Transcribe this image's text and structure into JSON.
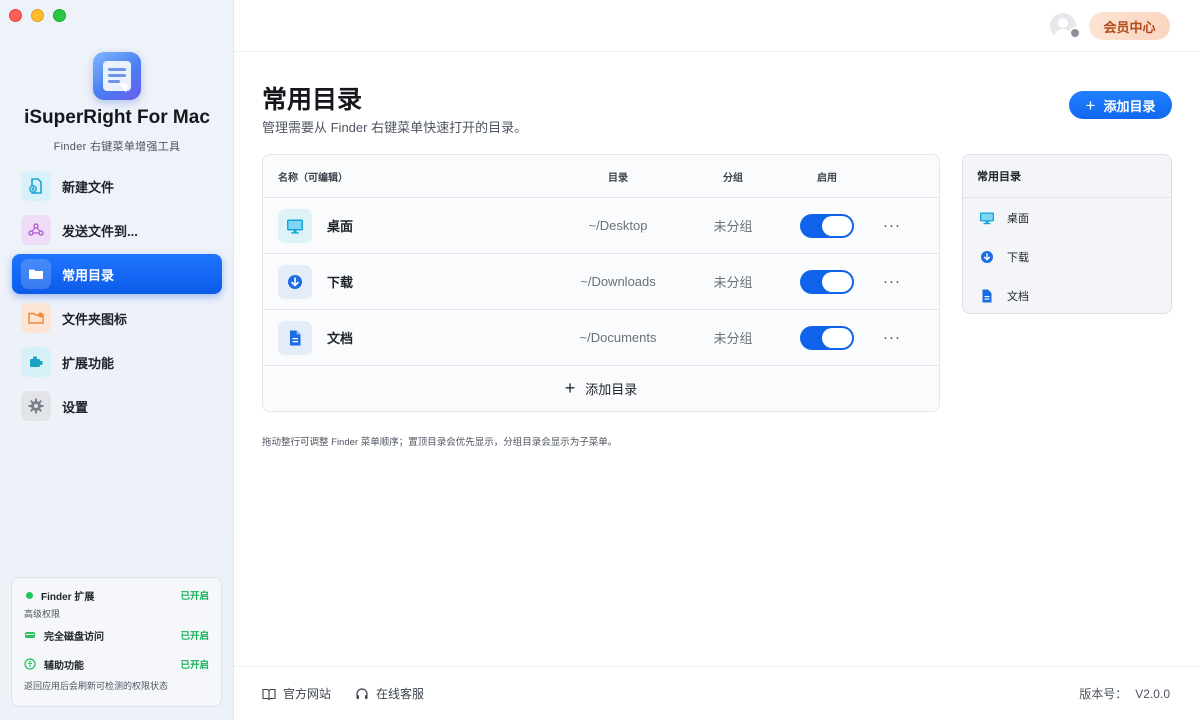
{
  "app": {
    "name": "iSuperRight For Mac",
    "subtitle": "Finder 右键菜单增强工具"
  },
  "sidebar": {
    "items": [
      {
        "label": "新建文件",
        "icon": "new-file-icon",
        "active": false
      },
      {
        "label": "发送文件到...",
        "icon": "send-file-icon",
        "active": false
      },
      {
        "label": "常用目录",
        "icon": "folder-icon",
        "active": true
      },
      {
        "label": "文件夹图标",
        "icon": "folder-image-icon",
        "active": false
      },
      {
        "label": "扩展功能",
        "icon": "extension-icon",
        "active": false
      },
      {
        "label": "设置",
        "icon": "gear-icon",
        "active": false
      }
    ]
  },
  "permissions": {
    "finder_ext": {
      "label": "Finder 扩展",
      "status": "已开启"
    },
    "advanced_label": "高级权限",
    "disk_access": {
      "label": "完全磁盘访问",
      "status": "已开启"
    },
    "accessibility": {
      "label": "辅助功能",
      "status": "已开启"
    },
    "note": "返回应用后会刷新可检测的权限状态"
  },
  "header": {
    "member_label": "会员中心"
  },
  "main": {
    "title": "常用目录",
    "description": "管理需要从 Finder 右键菜单快速打开的目录。",
    "add_button": "添加目录",
    "table": {
      "headers": {
        "name": "名称（可编辑）",
        "dir": "目录",
        "group": "分组",
        "enabled": "启用"
      },
      "rows": [
        {
          "name": "桌面",
          "dir": "~/Desktop",
          "group": "未分组",
          "enabled": true,
          "icon": "desktop-icon"
        },
        {
          "name": "下载",
          "dir": "~/Downloads",
          "group": "未分组",
          "enabled": true,
          "icon": "download-icon"
        },
        {
          "name": "文档",
          "dir": "~/Documents",
          "group": "未分组",
          "enabled": true,
          "icon": "document-icon"
        }
      ],
      "more_glyph": "···",
      "add_row_label": "添加目录"
    },
    "hint": "拖动整行可调整 Finder 菜单顺序；置顶目录会优先显示，分组目录会显示为子菜单。"
  },
  "preview": {
    "title": "常用目录",
    "items": [
      "桌面",
      "下载",
      "文档"
    ]
  },
  "footer": {
    "website": "官方网站",
    "support": "在线客服",
    "version_label": "版本号：",
    "version": "V2.0.0"
  },
  "colors": {
    "accent": "#0f63e8",
    "success": "#19b25a",
    "member_text": "#b04a18"
  }
}
